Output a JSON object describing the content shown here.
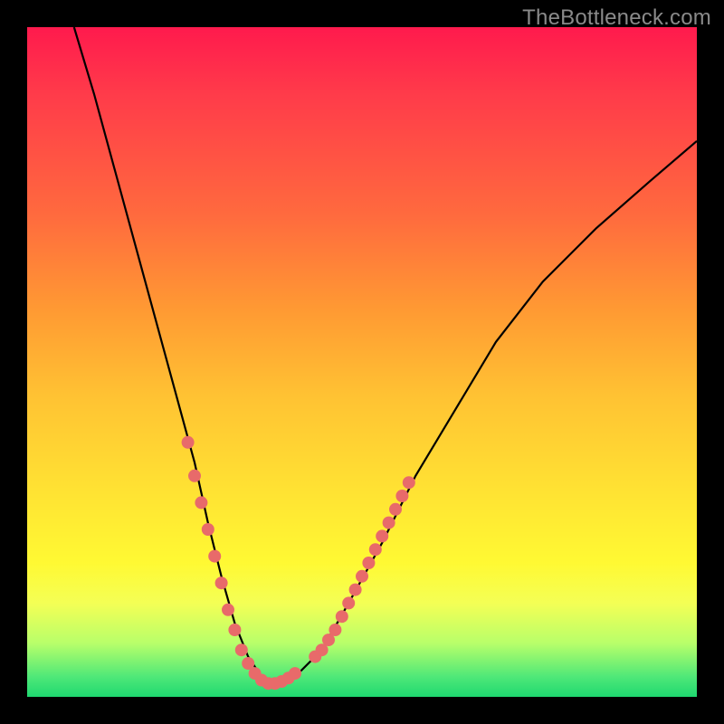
{
  "watermark": "TheBottleneck.com",
  "chart_data": {
    "type": "line",
    "title": "",
    "xlabel": "",
    "ylabel": "",
    "xlim": [
      0,
      100
    ],
    "ylim": [
      0,
      100
    ],
    "series": [
      {
        "name": "bottleneck-curve",
        "x": [
          7,
          10,
          13,
          16,
          19,
          22,
          25,
          27,
          29,
          31,
          33,
          35,
          37,
          40,
          44,
          48,
          53,
          58,
          64,
          70,
          77,
          85,
          93,
          100
        ],
        "y": [
          100,
          90,
          79,
          68,
          57,
          46,
          35,
          26,
          18,
          11,
          6,
          3,
          2,
          3,
          7,
          14,
          23,
          33,
          43,
          53,
          62,
          70,
          77,
          83
        ]
      }
    ],
    "markers": {
      "name": "highlight-dots",
      "color": "#e86a6a",
      "points": [
        {
          "x": 24,
          "y": 38
        },
        {
          "x": 25,
          "y": 33
        },
        {
          "x": 26,
          "y": 29
        },
        {
          "x": 27,
          "y": 25
        },
        {
          "x": 28,
          "y": 21
        },
        {
          "x": 29,
          "y": 17
        },
        {
          "x": 30,
          "y": 13
        },
        {
          "x": 31,
          "y": 10
        },
        {
          "x": 32,
          "y": 7
        },
        {
          "x": 33,
          "y": 5
        },
        {
          "x": 34,
          "y": 3.5
        },
        {
          "x": 35,
          "y": 2.5
        },
        {
          "x": 36,
          "y": 2
        },
        {
          "x": 37,
          "y": 2
        },
        {
          "x": 38,
          "y": 2.3
        },
        {
          "x": 39,
          "y": 2.8
        },
        {
          "x": 40,
          "y": 3.5
        },
        {
          "x": 43,
          "y": 6
        },
        {
          "x": 44,
          "y": 7
        },
        {
          "x": 45,
          "y": 8.5
        },
        {
          "x": 46,
          "y": 10
        },
        {
          "x": 47,
          "y": 12
        },
        {
          "x": 48,
          "y": 14
        },
        {
          "x": 49,
          "y": 16
        },
        {
          "x": 50,
          "y": 18
        },
        {
          "x": 51,
          "y": 20
        },
        {
          "x": 52,
          "y": 22
        },
        {
          "x": 53,
          "y": 24
        },
        {
          "x": 54,
          "y": 26
        },
        {
          "x": 55,
          "y": 28
        },
        {
          "x": 56,
          "y": 30
        },
        {
          "x": 57,
          "y": 32
        }
      ]
    }
  }
}
